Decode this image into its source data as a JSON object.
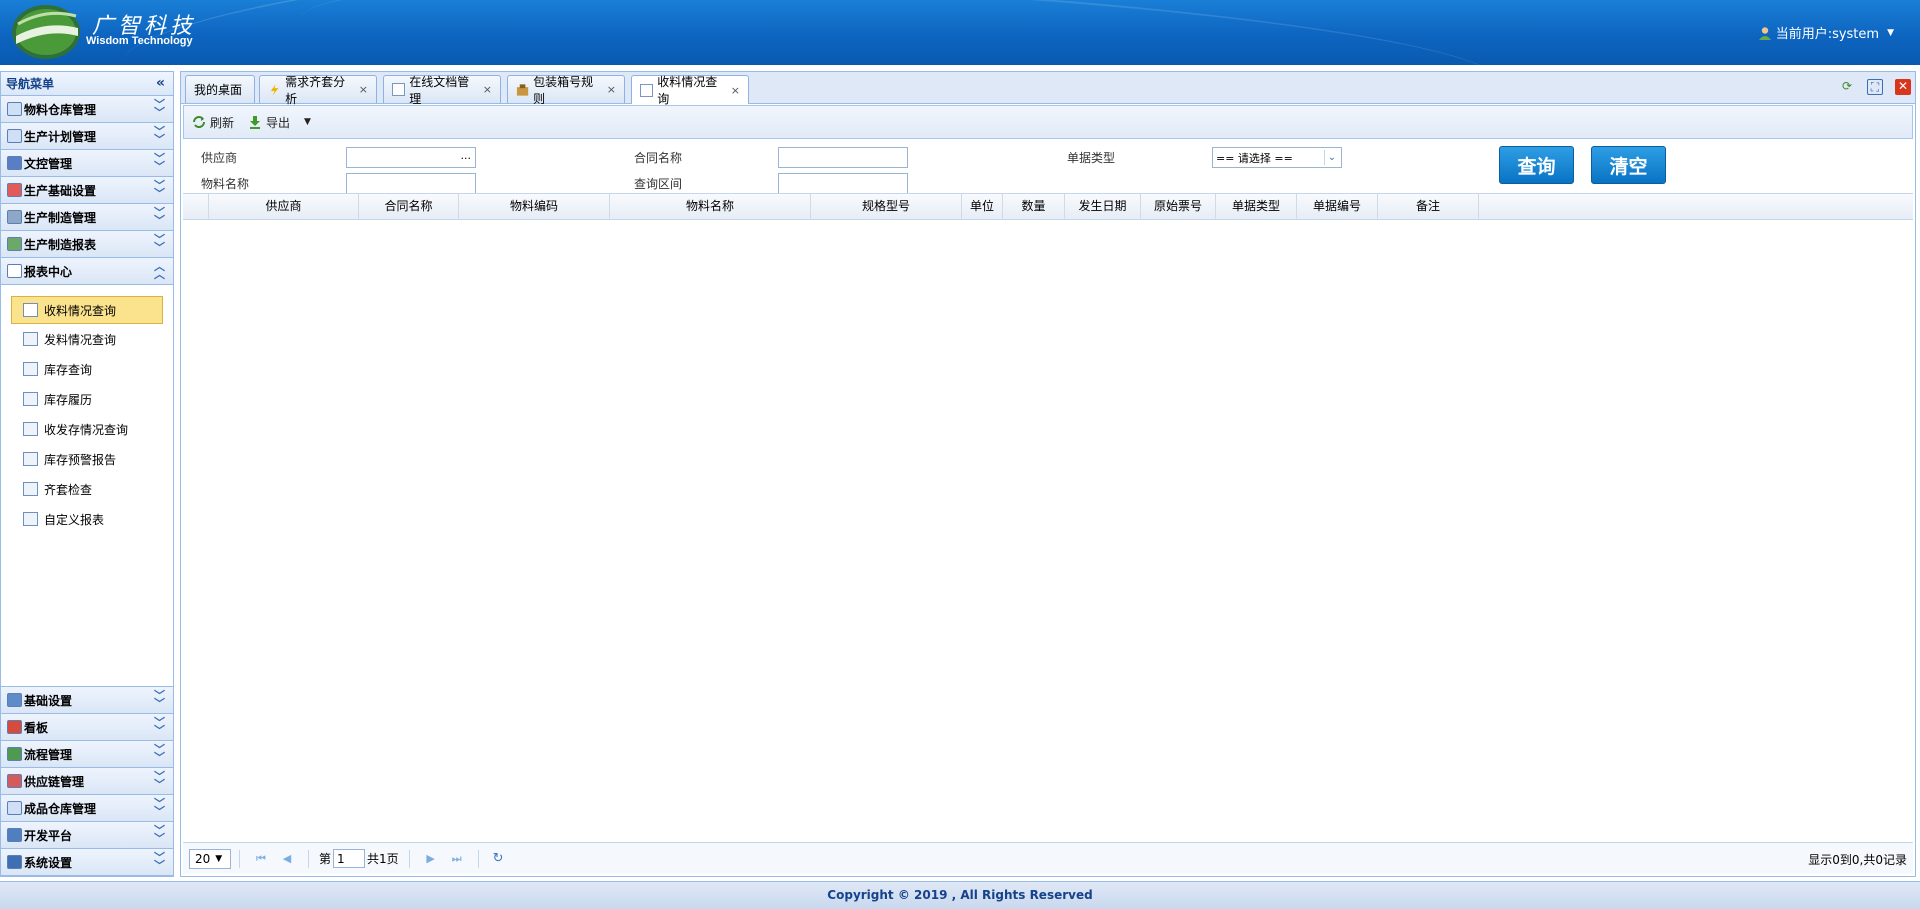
{
  "header": {
    "logo_cn": "广智科技",
    "logo_en": "Wisdom Technology",
    "user_label": "当前用户:system"
  },
  "sidebar": {
    "title": "导航菜单",
    "top_groups": [
      {
        "label": "物料仓库管理",
        "icon": "warehouse-icon"
      },
      {
        "label": "生产计划管理",
        "icon": "warehouse-icon"
      },
      {
        "label": "文控管理",
        "icon": "document-control-icon"
      },
      {
        "label": "生产基础设置",
        "icon": "settings-color-icon"
      },
      {
        "label": "生产制造管理",
        "icon": "gear-icon"
      },
      {
        "label": "生产制造报表",
        "icon": "chart-globe-icon"
      },
      {
        "label": "报表中心",
        "icon": "report-icon"
      }
    ],
    "report_items": [
      {
        "label": "收料情况查询",
        "icon": "window-icon"
      },
      {
        "label": "发料情况查询",
        "icon": "users-icon"
      },
      {
        "label": "库存查询",
        "icon": "stock-query-icon"
      },
      {
        "label": "库存履历",
        "icon": "history-icon"
      },
      {
        "label": "收发存情况查询",
        "icon": "ledger-icon"
      },
      {
        "label": "库存预警报告",
        "icon": "page-icon"
      },
      {
        "label": "齐套检查",
        "icon": "grid-icon"
      },
      {
        "label": "自定义报表",
        "icon": "custom-report-icon"
      }
    ],
    "bottom_groups": [
      {
        "label": "基础设置",
        "icon": "base-settings-icon"
      },
      {
        "label": "看板",
        "icon": "kanban-icon"
      },
      {
        "label": "流程管理",
        "icon": "flow-icon"
      },
      {
        "label": "供应链管理",
        "icon": "supply-chain-icon"
      },
      {
        "label": "成品仓库管理",
        "icon": "warehouse-icon"
      },
      {
        "label": "开发平台",
        "icon": "dev-platform-icon"
      },
      {
        "label": "系统设置",
        "icon": "system-icon"
      }
    ]
  },
  "tabs": [
    {
      "label": "我的桌面",
      "closable": false
    },
    {
      "label": "需求齐套分析",
      "closable": true
    },
    {
      "label": "在线文档管理",
      "closable": true
    },
    {
      "label": "包装箱号规则",
      "closable": true
    },
    {
      "label": "收料情况查询",
      "closable": true
    }
  ],
  "toolbar": {
    "refresh": "刷新",
    "export": "导出"
  },
  "filters": {
    "supplier_label": "供应商",
    "supplier_btn": "...",
    "contract_label": "合同名称",
    "doc_type_label": "单据类型",
    "doc_type_value": "== 请选择 ==",
    "material_label": "物料名称",
    "date_range_label": "查询区间",
    "query_button": "查询",
    "clear_button": "清空"
  },
  "grid": {
    "columns": [
      "供应商",
      "合同名称",
      "物料编码",
      "物料名称",
      "规格型号",
      "单位",
      "数量",
      "发生日期",
      "原始票号",
      "单据类型",
      "单据编号",
      "备注"
    ]
  },
  "pager": {
    "page_size": "20",
    "page_prefix": "第",
    "page_value": "1",
    "page_total": "共1页",
    "info": "显示0到0,共0记录"
  },
  "footer": {
    "copyright": "Copyright © 2019 , All Rights Reserved"
  }
}
